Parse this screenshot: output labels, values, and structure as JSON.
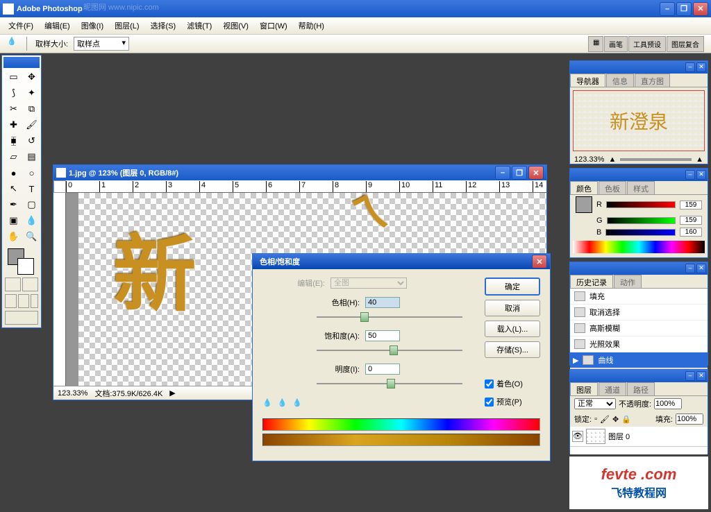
{
  "app": {
    "title": "Adobe Photoshop",
    "watermark": "昵图网 www.nipic.com"
  },
  "menus": [
    "文件(F)",
    "编辑(E)",
    "图像(I)",
    "图层(L)",
    "选择(S)",
    "滤镜(T)",
    "视图(V)",
    "窗口(W)",
    "帮助(H)"
  ],
  "optbar": {
    "label": "取样大小:",
    "value": "取样点"
  },
  "rightTabs": [
    "画笔",
    "工具预设",
    "图层复合"
  ],
  "doc": {
    "title": "1.jpg @ 123% (图层 0, RGB/8#)",
    "zoom": "123.33%",
    "status": "文档:375.9K/626.4K",
    "ruler": [
      "0",
      "1",
      "2",
      "3",
      "4",
      "5",
      "6",
      "7",
      "8",
      "9",
      "10",
      "11",
      "12",
      "13",
      "14"
    ]
  },
  "dialog": {
    "title": "色相/饱和度",
    "editLabel": "编辑(E):",
    "editValue": "全图",
    "hueLabel": "色相(H):",
    "hue": "40",
    "satLabel": "饱和度(A):",
    "sat": "50",
    "lightLabel": "明度(I):",
    "light": "0",
    "ok": "确定",
    "cancel": "取消",
    "load": "载入(L)...",
    "save": "存储(S)...",
    "colorize": "着色(O)",
    "preview": "预览(P)"
  },
  "nav": {
    "tabs": [
      "导航器",
      "信息",
      "直方图"
    ],
    "zoom": "123.33%",
    "preview": "新澄泉"
  },
  "color": {
    "tabs": [
      "颜色",
      "色板",
      "样式"
    ],
    "r": "159",
    "g": "159",
    "b": "160"
  },
  "history": {
    "tabs": [
      "历史记录",
      "动作"
    ],
    "items": [
      "填充",
      "取消选择",
      "高斯模糊",
      "光照效果",
      "曲线"
    ]
  },
  "layers": {
    "tabs": [
      "图层",
      "通道",
      "路径"
    ],
    "mode": "正常",
    "opacity": "100%",
    "opLabel": "不透明度:",
    "lock": "锁定:",
    "fill": "填充:",
    "fillVal": "100%",
    "layer0": "图层 0"
  },
  "logo": {
    "l1": "fevte .com",
    "l2": "飞特教程网"
  }
}
